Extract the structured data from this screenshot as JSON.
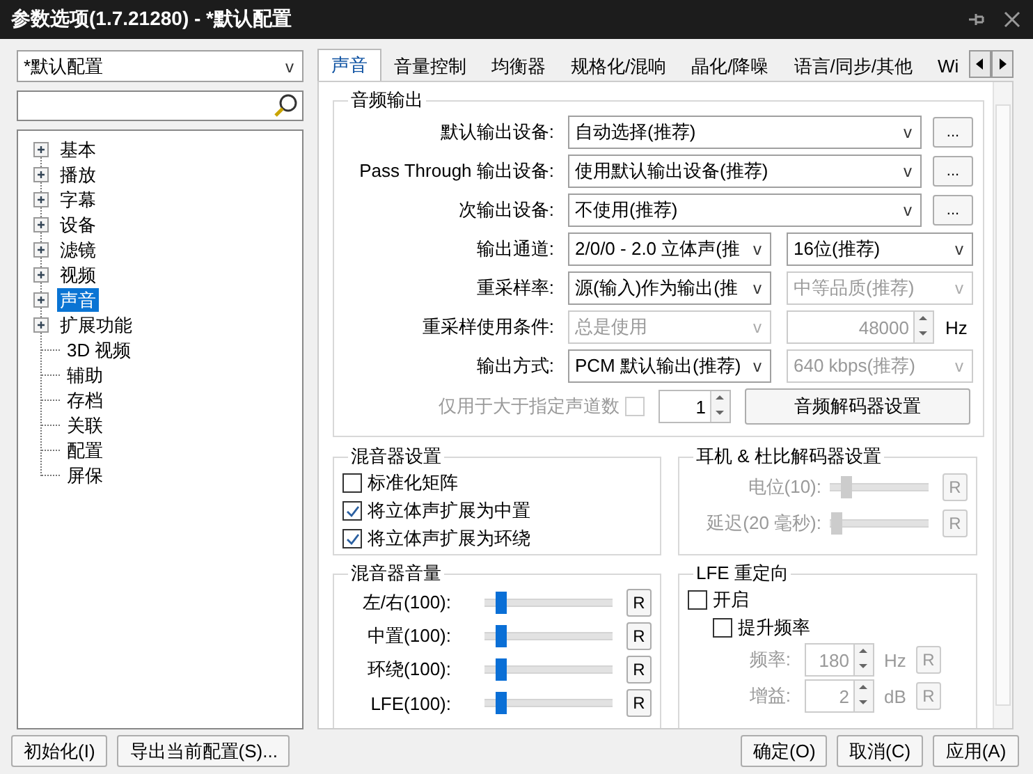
{
  "window": {
    "title": "参数选项(1.7.21280) - *默认配置"
  },
  "profile": {
    "value": "*默认配置",
    "arrow": "v"
  },
  "tree": [
    {
      "label": "基本",
      "expandable": true,
      "selected": false
    },
    {
      "label": "播放",
      "expandable": true,
      "selected": false
    },
    {
      "label": "字幕",
      "expandable": true,
      "selected": false
    },
    {
      "label": "设备",
      "expandable": true,
      "selected": false
    },
    {
      "label": "滤镜",
      "expandable": true,
      "selected": false
    },
    {
      "label": "视频",
      "expandable": true,
      "selected": false
    },
    {
      "label": "声音",
      "expandable": true,
      "selected": true
    },
    {
      "label": "扩展功能",
      "expandable": true,
      "selected": false
    },
    {
      "label": "3D 视频",
      "expandable": false,
      "selected": false
    },
    {
      "label": "辅助",
      "expandable": false,
      "selected": false
    },
    {
      "label": "存档",
      "expandable": false,
      "selected": false
    },
    {
      "label": "关联",
      "expandable": false,
      "selected": false
    },
    {
      "label": "配置",
      "expandable": false,
      "selected": false
    },
    {
      "label": "屏保",
      "expandable": false,
      "selected": false
    }
  ],
  "tabs": [
    {
      "label": "声音",
      "selected": true
    },
    {
      "label": "音量控制",
      "selected": false
    },
    {
      "label": "均衡器",
      "selected": false
    },
    {
      "label": "规格化/混响",
      "selected": false
    },
    {
      "label": "晶化/降噪",
      "selected": false
    },
    {
      "label": "语言/同步/其他",
      "selected": false
    },
    {
      "label": "Wi",
      "selected": false
    }
  ],
  "audio_output": {
    "title": "音频输出",
    "rows": [
      {
        "label": "默认输出设备:",
        "controls": [
          {
            "kind": "wide_combo",
            "value": "自动选择(推荐)",
            "arrow": "v",
            "disabled": false
          },
          {
            "kind": "more",
            "text": "..."
          }
        ]
      },
      {
        "label": "Pass Through 输出设备:",
        "controls": [
          {
            "kind": "wide_combo",
            "value": "使用默认输出设备(推荐)",
            "arrow": "v",
            "disabled": false
          },
          {
            "kind": "more",
            "text": "..."
          }
        ]
      },
      {
        "label": "次输出设备:",
        "controls": [
          {
            "kind": "wide_combo",
            "value": "不使用(推荐)",
            "arrow": "v",
            "disabled": false
          },
          {
            "kind": "more",
            "text": "..."
          }
        ]
      },
      {
        "label": "输出通道:",
        "controls": [
          {
            "kind": "half_combo",
            "value": "2/0/0 - 2.0 立体声(推",
            "arrow": "v",
            "disabled": false
          },
          {
            "kind": "half_combo",
            "value": "16位(推荐)",
            "arrow": "v",
            "disabled": false
          }
        ]
      },
      {
        "label": "重采样率:",
        "controls": [
          {
            "kind": "half_combo",
            "value": "源(输入)作为输出(推",
            "arrow": "v",
            "disabled": false
          },
          {
            "kind": "half_combo",
            "value": "中等品质(推荐)",
            "arrow": "v",
            "disabled": true
          }
        ]
      },
      {
        "label": "重采样使用条件:",
        "controls": [
          {
            "kind": "half_combo",
            "value": "总是使用",
            "arrow": "v",
            "disabled": true
          },
          {
            "kind": "spin",
            "value": "48000",
            "unit": "Hz",
            "disabled": true
          }
        ]
      },
      {
        "label": "输出方式:",
        "controls": [
          {
            "kind": "half_combo",
            "value": "PCM 默认输出(推荐)",
            "arrow": "v",
            "disabled": false
          },
          {
            "kind": "half_combo",
            "value": "640 kbps(推荐)",
            "arrow": "v",
            "disabled": true
          }
        ]
      }
    ],
    "channel_limit": {
      "label": "仅用于大于指定声道数",
      "checked": false,
      "disabled": true,
      "value": "1",
      "button": "音频解码器设置"
    }
  },
  "mixer_settings": {
    "title": "混音器设置",
    "options": [
      {
        "label": "标准化矩阵",
        "checked": false
      },
      {
        "label": "将立体声扩展为中置",
        "checked": true
      },
      {
        "label": "将立体声扩展为环绕",
        "checked": true
      }
    ]
  },
  "headphone": {
    "title": "耳机 & 杜比解码器设置",
    "sliders": [
      {
        "label": "电位(10):",
        "level": 0.12,
        "reset": "R",
        "disabled": true
      },
      {
        "label": "延迟(20 毫秒):",
        "level": 0.02,
        "reset": "R",
        "disabled": true
      }
    ]
  },
  "mixer_volume": {
    "title": "混音器音量",
    "sliders": [
      {
        "label": "左/右(100):",
        "level": 0.1,
        "reset": "R",
        "disabled": false
      },
      {
        "label": "中置(100):",
        "level": 0.1,
        "reset": "R",
        "disabled": false
      },
      {
        "label": "环绕(100):",
        "level": 0.1,
        "reset": "R",
        "disabled": false
      },
      {
        "label": "LFE(100):",
        "level": 0.1,
        "reset": "R",
        "disabled": false
      }
    ]
  },
  "lfe": {
    "title": "LFE 重定向",
    "options": [
      {
        "label": "开启",
        "checked": false,
        "children": [
          {
            "label": "提升频率",
            "checked": false
          }
        ]
      }
    ],
    "params": [
      {
        "label": "频率:",
        "value": "180",
        "unit": "Hz",
        "reset": "R",
        "disabled": true
      },
      {
        "label": "增益:",
        "value": "2",
        "unit": "dB",
        "reset": "R",
        "disabled": true
      }
    ]
  },
  "footer": {
    "left": [
      "初始化(I)",
      "导出当前配置(S)..."
    ],
    "right": [
      "确定(O)",
      "取消(C)",
      "应用(A)"
    ]
  }
}
